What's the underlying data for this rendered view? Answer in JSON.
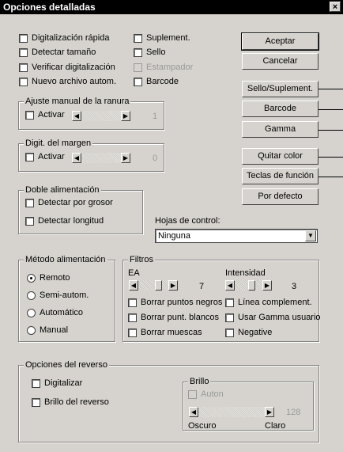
{
  "window": {
    "title": "Opciones detalladas",
    "close_glyph": "×"
  },
  "options": {
    "digitalizacion_rapida": "Digitalización rápida",
    "detectar_tamano": "Detectar tamaño",
    "verificar_digitalizacion": "Verificar digitalización",
    "nuevo_archivo": "Nuevo archivo autom.",
    "suplement": "Suplement.",
    "sello": "Sello",
    "estampador": "Estampador",
    "barcode": "Barcode"
  },
  "buttons": {
    "aceptar": "Aceptar",
    "cancelar": "Cancelar",
    "sello_suplement": "Sello/Suplement.",
    "barcode": "Barcode",
    "gamma": "Gamma",
    "quitar_color": "Quitar color",
    "teclas_funcion": "Teclas de función",
    "por_defecto": "Por defecto"
  },
  "ajuste_ranura": {
    "legend": "Ajuste manual de la ranura",
    "activar": "Activar",
    "value": "1"
  },
  "digit_margen": {
    "legend": "Digit. del margen",
    "activar": "Activar",
    "value": "0"
  },
  "doble_alimentacion": {
    "legend": "Doble alimentación",
    "grosor": "Detectar por grosor",
    "longitud": "Detectar longitud"
  },
  "hojas_control": {
    "label": "Hojas de control:",
    "selected": "Ninguna"
  },
  "metodo_alimentacion": {
    "legend": "Método alimentación",
    "options": [
      "Remoto",
      "Semi-autom.",
      "Automático",
      "Manual"
    ],
    "selected_index": 0
  },
  "filtros": {
    "legend": "Filtros",
    "ea_label": "EA",
    "ea_value": "7",
    "intensidad_label": "Intensidad",
    "intensidad_value": "3",
    "borrar_negros": "Borrar puntos negros",
    "borrar_blancos": "Borrar punt. blancos",
    "borrar_muescas": "Borrar muescas",
    "linea_complement": "Línea complement.",
    "usar_gamma": "Usar Gamma usuario",
    "negative": "Negative"
  },
  "reverso": {
    "legend": "Opciones del reverso",
    "digitalizar": "Digitalizar",
    "brillo_reverso": "Brillo del reverso",
    "brillo_group": "Brillo",
    "auton": "Auton",
    "brillo_value": "128",
    "oscuro": "Oscuro",
    "claro": "Claro"
  }
}
